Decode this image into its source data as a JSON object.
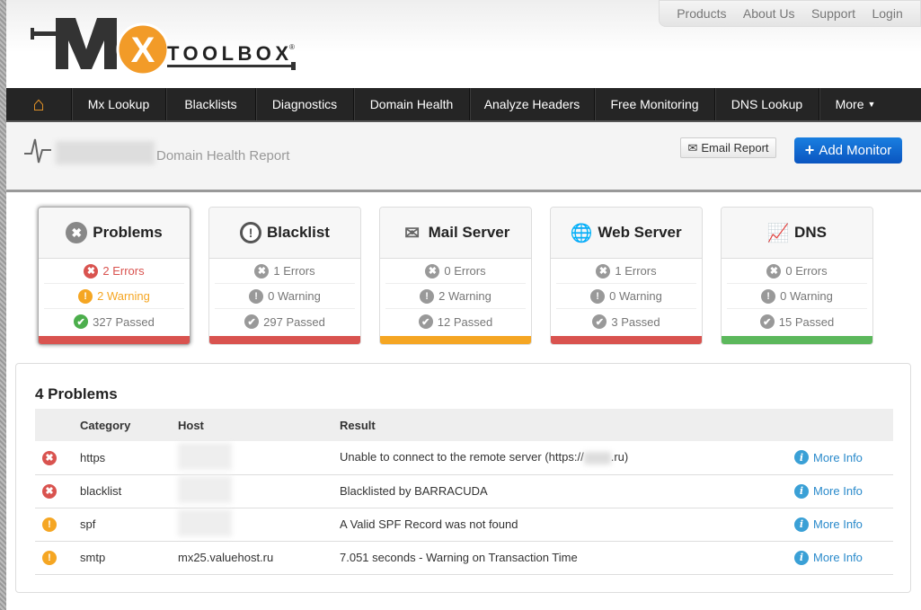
{
  "top_links": [
    "Products",
    "About Us",
    "Support",
    "Login"
  ],
  "logo": {
    "text": "MX TOOLBOX"
  },
  "nav": [
    "Mx Lookup",
    "Blacklists",
    "Diagnostics",
    "Domain Health",
    "Analyze Headers",
    "Free Monitoring",
    "DNS Lookup",
    "More"
  ],
  "header": {
    "title": "Domain Health Report",
    "email_report": "Email Report",
    "add_monitor": "Add Monitor"
  },
  "cards": [
    {
      "title": "Problems",
      "errors": "2 Errors",
      "warning": "2 Warning",
      "passed": "327 Passed",
      "status_color": "#d9534f"
    },
    {
      "title": "Blacklist",
      "errors": "1 Errors",
      "warning": "0 Warning",
      "passed": "297 Passed",
      "status_color": "#d9534f"
    },
    {
      "title": "Mail Server",
      "errors": "0 Errors",
      "warning": "2 Warning",
      "passed": "12 Passed",
      "status_color": "#f5a623"
    },
    {
      "title": "Web Server",
      "errors": "1 Errors",
      "warning": "0 Warning",
      "passed": "3 Passed",
      "status_color": "#d9534f"
    },
    {
      "title": "DNS",
      "errors": "0 Errors",
      "warning": "0 Warning",
      "passed": "15 Passed",
      "status_color": "#5cb85c"
    }
  ],
  "problems": {
    "title": "4 Problems",
    "columns": [
      "Category",
      "Host",
      "Result"
    ],
    "rows": [
      {
        "status": "error",
        "category": "https",
        "host": "",
        "result_a": "Unable to connect to the remote server (https://",
        "result_b": ".ru)",
        "more": "More Info"
      },
      {
        "status": "error",
        "category": "blacklist",
        "host": "",
        "result_a": "Blacklisted by BARRACUDA",
        "result_b": "",
        "more": "More Info"
      },
      {
        "status": "warning",
        "category": "spf",
        "host": "",
        "result_a": "A Valid SPF Record was not found",
        "result_b": "",
        "more": "More Info"
      },
      {
        "status": "warning",
        "category": "smtp",
        "host": "mx25.valuehost.ru",
        "result_a": "7.051 seconds - Warning on Transaction Time",
        "result_b": "",
        "more": "More Info"
      }
    ]
  }
}
